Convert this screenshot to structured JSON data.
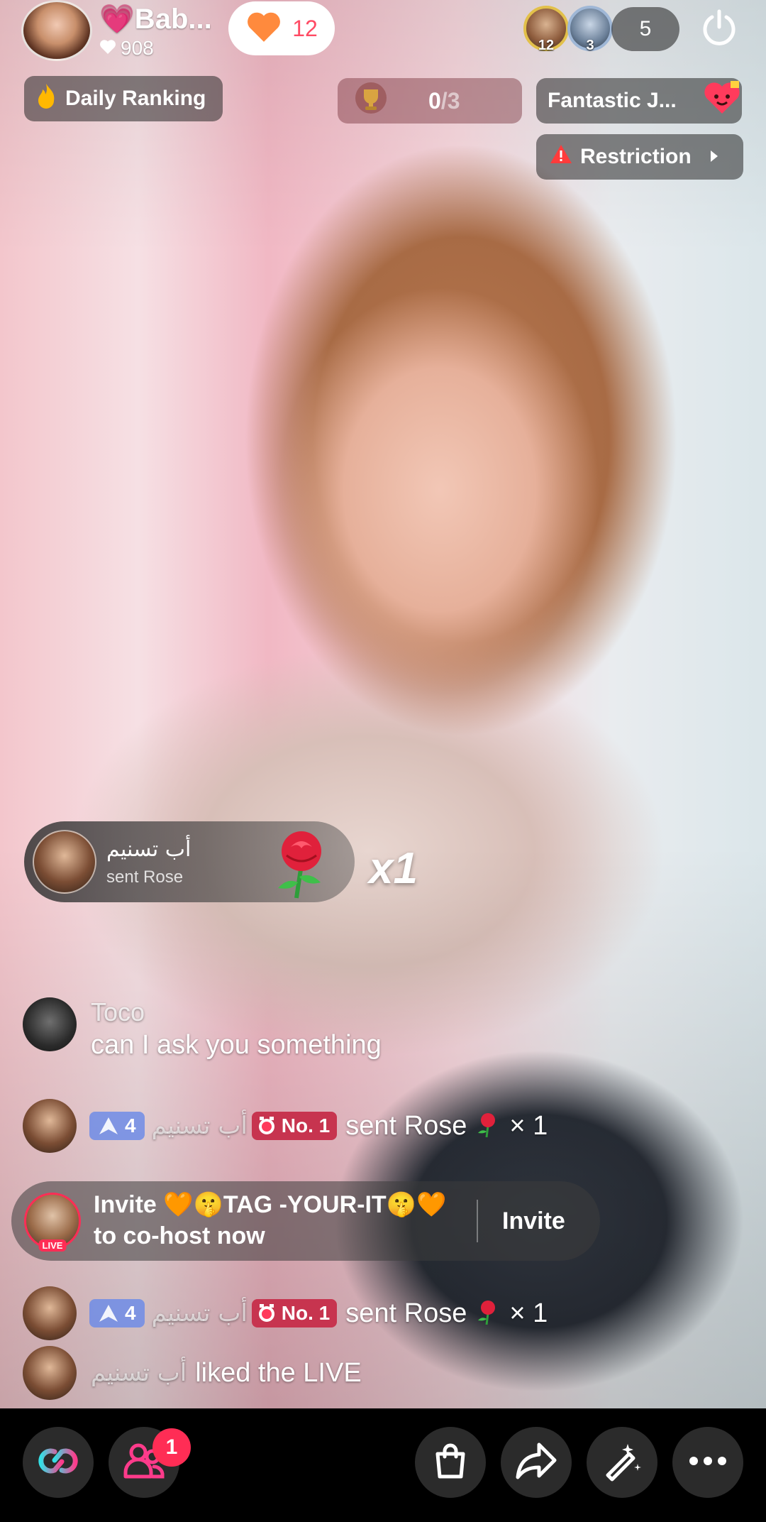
{
  "host": {
    "name": "💗Bab...",
    "likes": "908",
    "follow_count": "12"
  },
  "viewers": {
    "top1_rank": "12",
    "top2_rank": "3",
    "count": "5"
  },
  "daily_ranking": {
    "label": "Daily Ranking"
  },
  "challenge": {
    "progress": "0",
    "total": "/3"
  },
  "fantastic": {
    "label": "Fantastic J..."
  },
  "restriction": {
    "label": "Restriction"
  },
  "gift_popup": {
    "sender": "أب تسنيم",
    "description": "sent Rose",
    "multiplier": "x1"
  },
  "comments": [
    {
      "user": "Toco",
      "text": "can I ask you something"
    }
  ],
  "gift_lines": [
    {
      "level": "4",
      "user": "أب تسنيم",
      "rank": "No. 1",
      "text": "sent Rose",
      "count": "× 1"
    },
    {
      "level": "4",
      "user": "أب تسنيم",
      "rank": "No. 1",
      "text": "sent Rose",
      "count": "× 1"
    }
  ],
  "invite_card": {
    "line1": "Invite 🧡🤫TAG -YOUR-IT🤫🧡",
    "line2": "to co-host now",
    "button": "Invite",
    "live_tag": "LIVE"
  },
  "like_line": {
    "user": "أب تسنيم",
    "text": "liked the LIVE"
  },
  "bottom_bar": {
    "notification_count": "1"
  },
  "colors": {
    "accent": "#ff2d55",
    "follow_heart": "#ff8a3d",
    "level_badge": "#6e8ce6",
    "rank_badge": "#c7344f"
  },
  "icons": [
    "heart-icon",
    "power-icon",
    "fire-hand-icon",
    "trophy-icon",
    "gift-heart-icon",
    "warning-icon",
    "chevron-right-icon",
    "rose-icon",
    "alarm-icon",
    "link-icon",
    "users-icon",
    "shopping-bag-icon",
    "share-icon",
    "magic-wand-icon",
    "more-icon"
  ]
}
